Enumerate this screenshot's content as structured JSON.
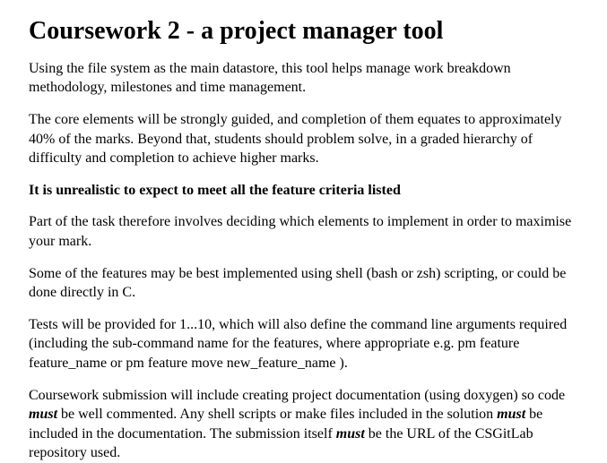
{
  "doc": {
    "title": "Coursework 2 - a project manager tool",
    "p1": "Using the file system as the main datastore, this tool helps manage work breakdown methodology, milestones and time management.",
    "p2": "The core elements will be strongly guided, and completion of them equates to approximately 40% of the marks. Beyond that, students should problem solve, in a graded hierarchy of difficulty and completion to achieve higher marks.",
    "boldline": "It is unrealistic to expect to meet all the feature criteria listed",
    "p3": "Part of the task therefore involves deciding which elements to implement in order to maximise your mark.",
    "p4": "Some of the features may be best implemented using shell (bash or zsh) scripting, or could be done directly in C.",
    "p5": "Tests will be provided for 1...10, which will also define the command line arguments required (including the sub-command name for the features, where appropriate e.g. pm feature feature_name or pm feature move new_feature_name ).",
    "p6a": "Coursework submission will include creating project documentation (using doxygen) so code ",
    "must1": "must",
    "p6b": " be well commented. Any shell scripts or make files included in the solution ",
    "must2": "must",
    "p6c": " be included in the documentation. The submission itself ",
    "must3": "must",
    "p6d": " be the URL of the CSGitLab repository used."
  }
}
